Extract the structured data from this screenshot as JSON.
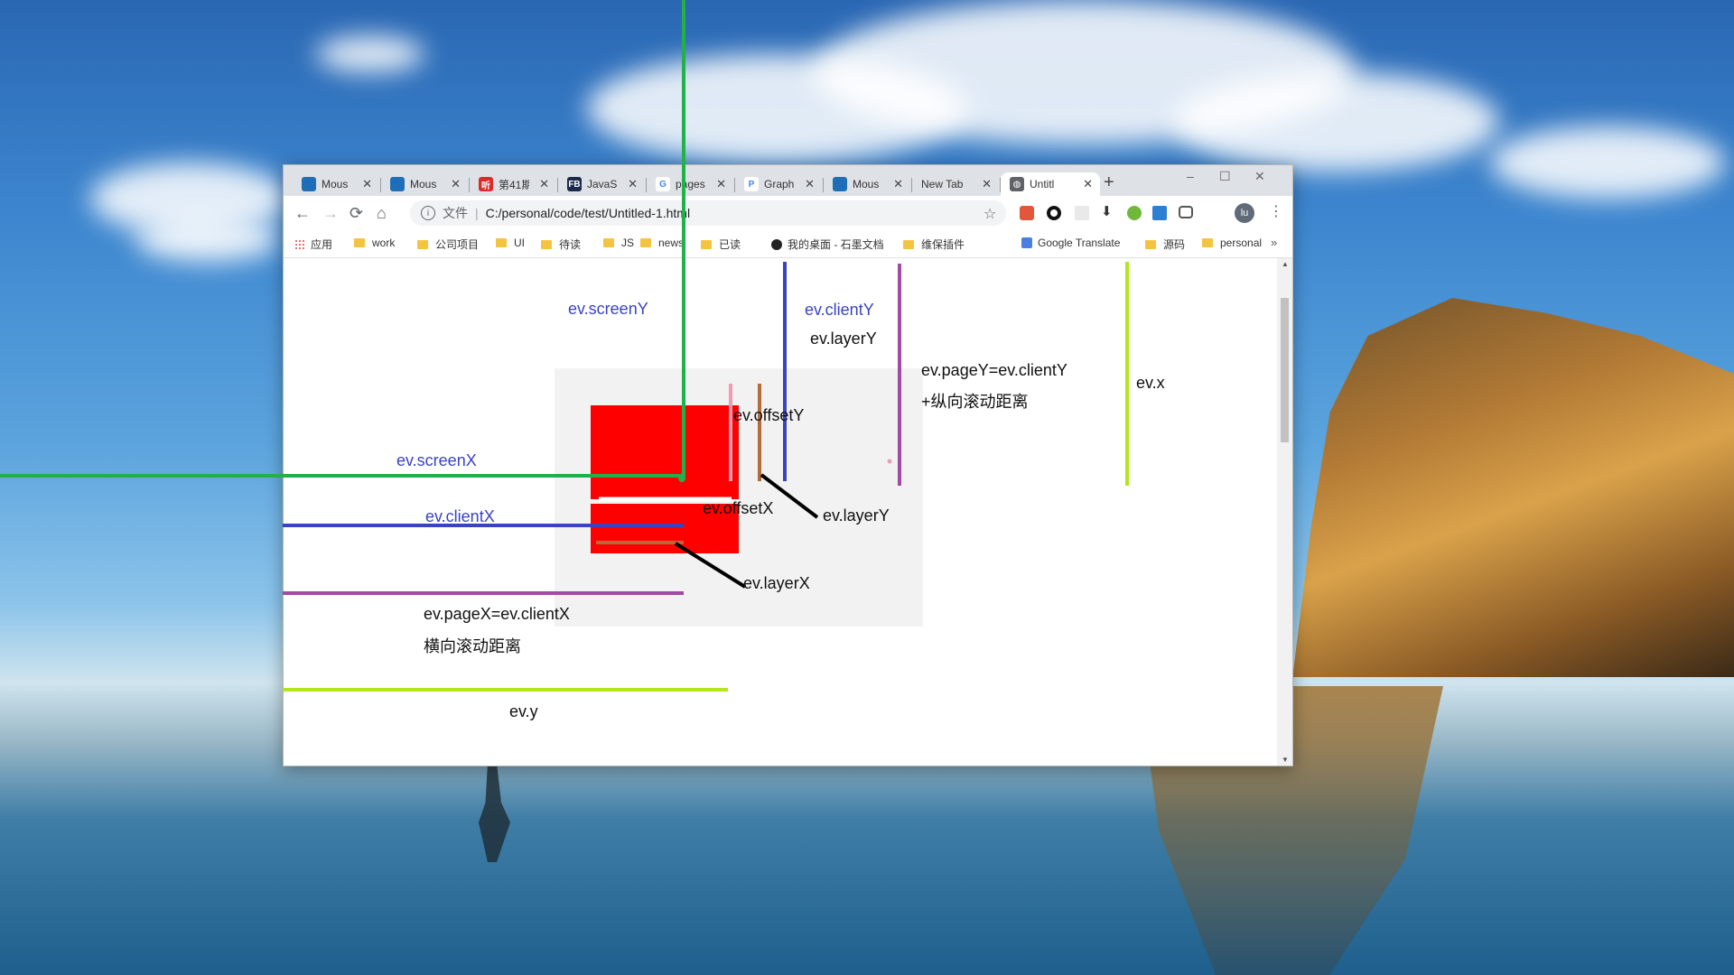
{
  "tabs": [
    {
      "label": "Mous",
      "icon": "paw-icon",
      "color": "#1f6fb5",
      "glyph": "🐾"
    },
    {
      "label": "Mous",
      "icon": "paw-icon",
      "color": "#1f6fb5",
      "glyph": "🐾"
    },
    {
      "label": "第41期",
      "icon": "news-icon",
      "color": "#d92b2b",
      "glyph": "听"
    },
    {
      "label": "JavaS",
      "icon": "fb-icon",
      "color": "#1b2a4a",
      "glyph": "FB"
    },
    {
      "label": "pages",
      "icon": "google-icon",
      "color": "#ffffff",
      "glyph": "G"
    },
    {
      "label": "Graph",
      "icon": "p-icon",
      "color": "#ffffff",
      "glyph": "P"
    },
    {
      "label": "Mous",
      "icon": "paw-icon",
      "color": "#1f6fb5",
      "glyph": "🐾"
    },
    {
      "label": "New Tab",
      "icon": "",
      "color": "",
      "glyph": ""
    },
    {
      "label": "Untitl",
      "icon": "globe-icon",
      "color": "#5f6368",
      "glyph": "◍"
    }
  ],
  "window_controls": {
    "minimize": "–",
    "maximize": "☐",
    "close": "✕"
  },
  "address": {
    "scheme": "文件",
    "url": "C:/personal/code/test/Untitled-1.html"
  },
  "profile_initials": "lu",
  "bookmarks": [
    {
      "label": "应用",
      "type": "apps"
    },
    {
      "label": "work",
      "type": "folder"
    },
    {
      "label": "公司项目",
      "type": "folder"
    },
    {
      "label": "UI",
      "type": "folder"
    },
    {
      "label": "待读",
      "type": "folder"
    },
    {
      "label": "JS",
      "type": "folder"
    },
    {
      "label": "news",
      "type": "folder"
    },
    {
      "label": "已读",
      "type": "folder"
    },
    {
      "label": "我的桌面 - 石墨文档",
      "type": "site"
    },
    {
      "label": "维保插件",
      "type": "folder"
    },
    {
      "label": "Google Translate",
      "type": "site"
    },
    {
      "label": "源码",
      "type": "folder"
    },
    {
      "label": "personal",
      "type": "folder"
    }
  ],
  "bookmarks_more": "»",
  "annotations": {
    "screenY": "ev.screenY",
    "clientY": "ev.clientY",
    "layerY_top": "ev.layerY",
    "pageY_line1": "ev.pageY=ev.clientY",
    "pageY_line2": "+纵向滚动距离",
    "x": "ev.x",
    "offsetY": "ev.offsetY",
    "screenX": "ev.screenX",
    "clientX": "ev.clientX",
    "offsetX": "ev.offsetX",
    "layerY_bottom": "ev.layerY",
    "layerX": "ev.layerX",
    "pageX_line1": "ev.pageX=ev.clientX",
    "pageX_line2": "横向滚动距离",
    "y": "ev.y"
  },
  "colors": {
    "green": "#22b04b",
    "blue": "#3a43c0",
    "purple": "#a24aa6",
    "lime": "#b5e61d",
    "red": "#ff0000",
    "brown": "#b56a3a",
    "pink": "#f29ab5",
    "gray_box": "#f2f2f2"
  }
}
